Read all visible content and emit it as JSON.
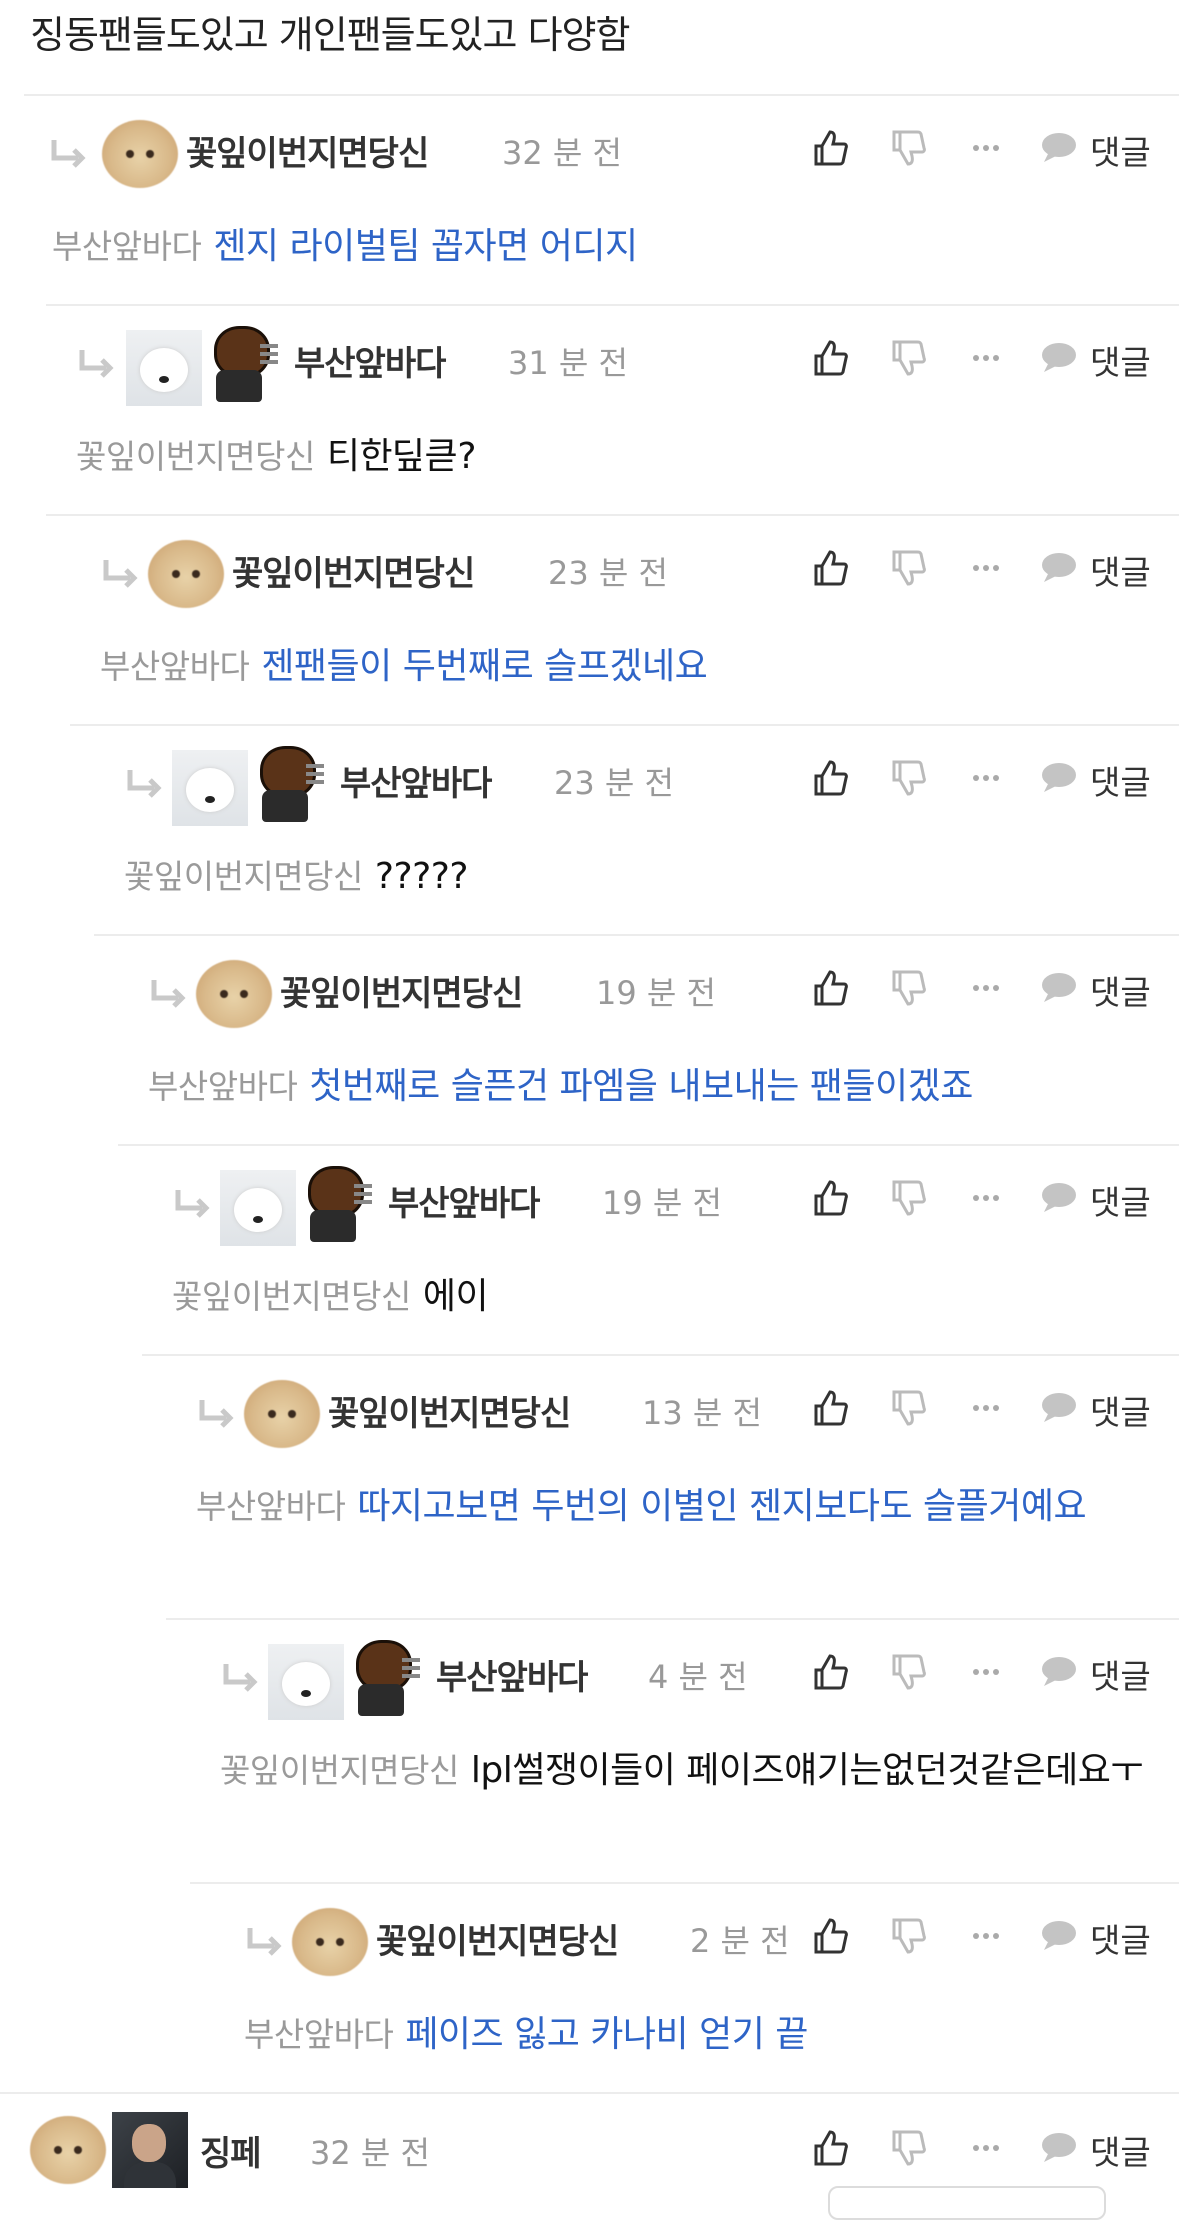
{
  "top_text": "징동팬들도있고 개인팬들도있고 다양함",
  "reply_label": "댓글",
  "comments": [
    {
      "nick": "꽃잎이번지면당신",
      "time": "32 분 전",
      "mention": "부산앞바다",
      "text": "젠지 라이벌팀 꼽자면 어디지",
      "color": "blue"
    },
    {
      "nick": "부산앞바다",
      "time": "31 분 전",
      "mention": "꽃잎이번지면당신",
      "text": "티한딮큳?",
      "color": "black"
    },
    {
      "nick": "꽃잎이번지면당신",
      "time": "23 분 전",
      "mention": "부산앞바다",
      "text": "젠팬들이 두번째로 슬프겠네요",
      "color": "blue"
    },
    {
      "nick": "부산앞바다",
      "time": "23 분 전",
      "mention": "꽃잎이번지면당신",
      "text": "?????",
      "color": "black"
    },
    {
      "nick": "꽃잎이번지면당신",
      "time": "19 분 전",
      "mention": "부산앞바다",
      "text": "첫번째로 슬픈건 파엠을 내보내는 팬들이겠죠",
      "color": "blue"
    },
    {
      "nick": "부산앞바다",
      "time": "19 분 전",
      "mention": "꽃잎이번지면당신",
      "text": "에이",
      "color": "black"
    },
    {
      "nick": "꽃잎이번지면당신",
      "time": "13 분 전",
      "mention": "부산앞바다",
      "text": "따지고보면 두번의 이별인 젠지보다도 슬플거예요",
      "color": "blue"
    },
    {
      "nick": "부산앞바다",
      "time": "4 분 전",
      "mention": "꽃잎이번지면당신",
      "text": "lpl썰쟁이들이 페이즈얘기는없던것같은데요ㅜ",
      "color": "black"
    },
    {
      "nick": "꽃잎이번지면당신",
      "time": "2 분 전",
      "mention": "부산앞바다",
      "text": "페이즈 잃고 카나비 얻기 끝",
      "color": "blue"
    },
    {
      "nick": "징페",
      "time": "32 분 전"
    }
  ]
}
